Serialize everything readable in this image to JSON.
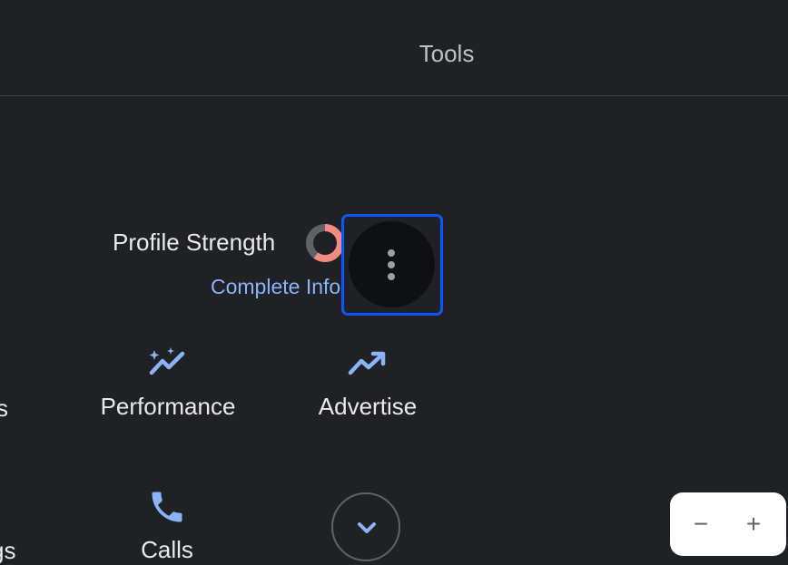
{
  "header": {
    "title": "Tools"
  },
  "profile": {
    "label": "Profile Strength",
    "link": "Complete Info",
    "strength": 0.6,
    "colors": {
      "filled": "#f28b82",
      "track": "#5f6368"
    }
  },
  "actions": [
    {
      "label": "Performance",
      "icon": "sparkle-trend-icon"
    },
    {
      "label": "Advertise",
      "icon": "trending-up-icon"
    },
    {
      "label": "Calls",
      "icon": "phone-icon"
    }
  ],
  "partial_labels": {
    "left_top": "s",
    "left_bottom": "gs"
  },
  "menu": {
    "icon": "more-vert-icon"
  },
  "expand": {
    "icon": "chevron-down-icon"
  },
  "zoom": {
    "minus": "−",
    "plus": "+"
  },
  "colors": {
    "accent": "#8ab4f8",
    "focus": "#0b57ff",
    "background": "#202124"
  }
}
